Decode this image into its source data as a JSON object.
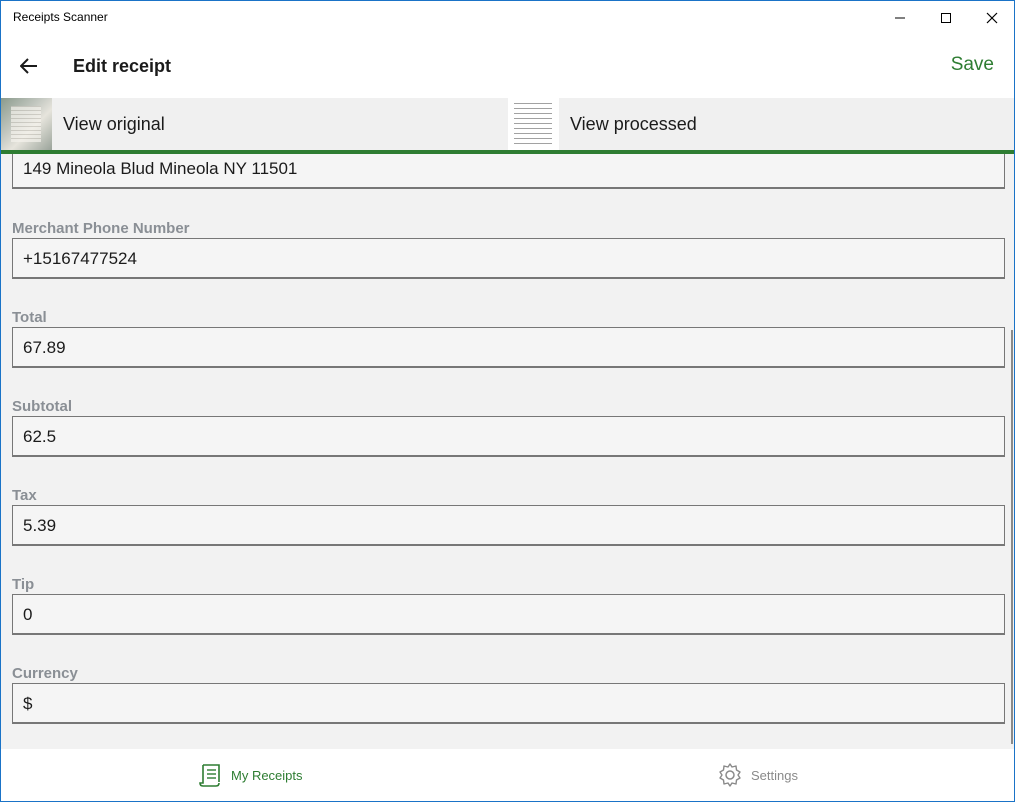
{
  "window": {
    "title": "Receipts Scanner"
  },
  "header": {
    "title": "Edit receipt",
    "save_label": "Save"
  },
  "image_tabs": [
    {
      "label": "View original"
    },
    {
      "label": "View processed"
    }
  ],
  "form": {
    "address": {
      "value": "149 Mineola Blud Mineola NY 11501"
    },
    "fields": [
      {
        "label": "Merchant Phone Number",
        "value": "+15167477524"
      },
      {
        "label": "Total",
        "value": "67.89"
      },
      {
        "label": "Subtotal",
        "value": "62.5"
      },
      {
        "label": "Tax",
        "value": "5.39"
      },
      {
        "label": "Tip",
        "value": "0"
      },
      {
        "label": "Currency",
        "value": "$"
      }
    ]
  },
  "bottom_nav": {
    "items": [
      {
        "label": "My Receipts",
        "icon": "receipt-icon",
        "active": true
      },
      {
        "label": "Settings",
        "icon": "gear-icon",
        "active": false
      }
    ]
  },
  "colors": {
    "accent": "#2e7d32",
    "label_gray": "#8a8f95",
    "form_bg": "#f2f2f2"
  }
}
